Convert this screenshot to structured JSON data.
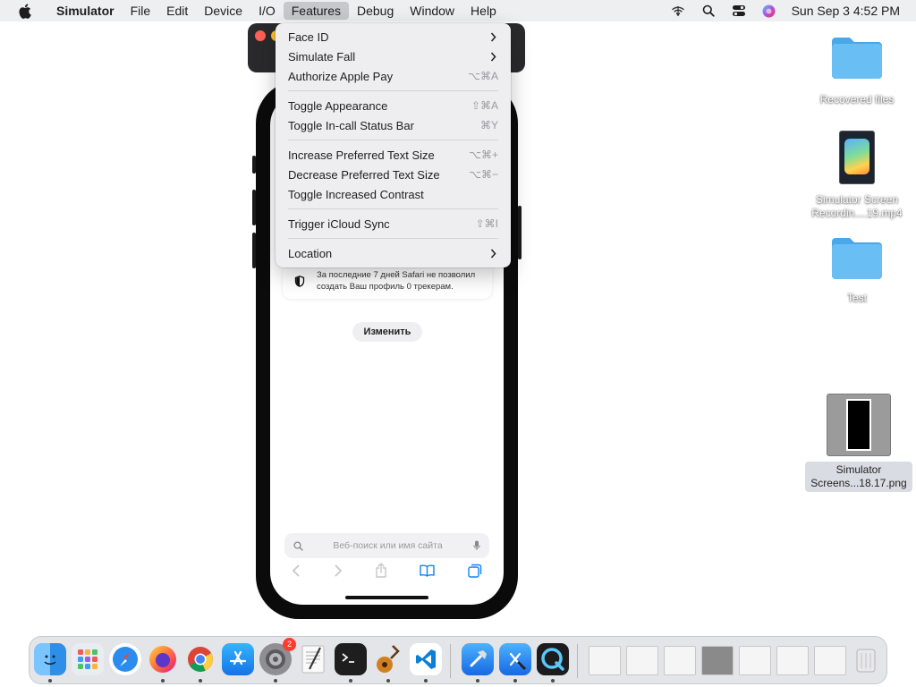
{
  "menubar": {
    "app_name": "Simulator",
    "menus": [
      "File",
      "Edit",
      "Device",
      "I/O",
      "Features",
      "Debug",
      "Window",
      "Help"
    ],
    "active_menu": "Features",
    "clock": "Sun Sep 3  4:52 PM",
    "status_icons": [
      "wifi-off-icon",
      "search-icon",
      "control-center-icon",
      "siri-icon"
    ]
  },
  "features_menu": {
    "groups": [
      [
        {
          "label": "Face ID",
          "shortcut": "",
          "submenu": true
        },
        {
          "label": "Simulate Fall",
          "shortcut": "",
          "submenu": true
        },
        {
          "label": "Authorize Apple Pay",
          "shortcut": "⌥⌘A",
          "submenu": false
        }
      ],
      [
        {
          "label": "Toggle Appearance",
          "shortcut": "⇧⌘A",
          "submenu": false
        },
        {
          "label": "Toggle In-call Status Bar",
          "shortcut": "⌘Y",
          "submenu": false
        }
      ],
      [
        {
          "label": "Increase Preferred Text Size",
          "shortcut": "⌥⌘+",
          "submenu": false
        },
        {
          "label": "Decrease Preferred Text Size",
          "shortcut": "⌥⌘−",
          "submenu": false
        },
        {
          "label": "Toggle Increased Contrast",
          "shortcut": "",
          "submenu": false
        }
      ],
      [
        {
          "label": "Trigger iCloud Sync",
          "shortcut": "⇧⌘I",
          "submenu": false
        }
      ],
      [
        {
          "label": "Location",
          "shortcut": "",
          "submenu": true
        }
      ]
    ]
  },
  "simulator": {
    "privacy_text": "За последние 7 дней Safari не позволил создать Ваш профиль 0 трекерам.",
    "edit_button": "Изменить",
    "search_placeholder": "Веб-поиск или имя сайта"
  },
  "desktop": {
    "items": [
      {
        "label": "Recovered files",
        "kind": "folder"
      },
      {
        "label": "Simulator Screen Recordin....19.mp4",
        "kind": "video"
      },
      {
        "label": "Test",
        "kind": "folder"
      },
      {
        "label": "Simulator Screens...18.17.png",
        "kind": "image"
      }
    ]
  },
  "dock": {
    "apps": [
      {
        "name": "Finder",
        "icon": "finder-icon",
        "running": true
      },
      {
        "name": "Launchpad",
        "icon": "launchpad-icon",
        "running": false
      },
      {
        "name": "Safari",
        "icon": "safari-icon",
        "running": false
      },
      {
        "name": "Firefox",
        "icon": "firefox-icon",
        "running": true
      },
      {
        "name": "Chrome",
        "icon": "chrome-icon",
        "running": true
      },
      {
        "name": "App Store",
        "icon": "app-store-icon",
        "running": false
      },
      {
        "name": "System Settings",
        "icon": "settings-icon",
        "running": true,
        "badge": "2"
      },
      {
        "name": "TextEdit",
        "icon": "textedit-icon",
        "running": false
      },
      {
        "name": "Terminal",
        "icon": "terminal-icon",
        "running": true
      },
      {
        "name": "Instruments",
        "icon": "guitar-icon",
        "running": true
      },
      {
        "name": "VS Code",
        "icon": "vscode-icon",
        "running": true
      },
      {
        "name": "Xcode",
        "icon": "hammer-icon",
        "running": true
      },
      {
        "name": "Xcode Tools",
        "icon": "xcode-icon",
        "running": true
      },
      {
        "name": "QuickTime",
        "icon": "quicktime-icon",
        "running": true
      }
    ],
    "recent_thumbnails": 7,
    "trash_icon": "trash-icon"
  }
}
